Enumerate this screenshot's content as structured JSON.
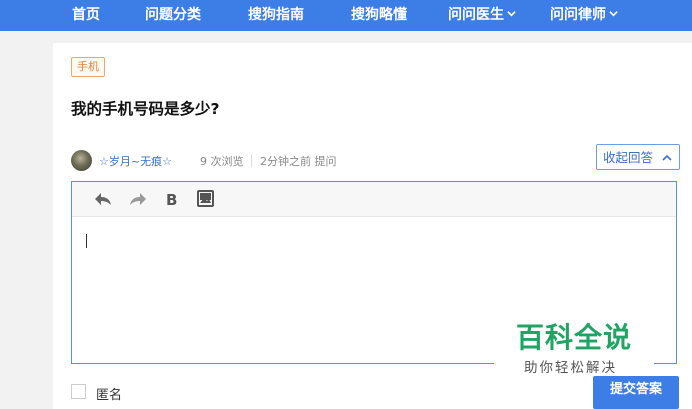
{
  "nav": {
    "items": [
      {
        "label": "首页"
      },
      {
        "label": "问题分类"
      },
      {
        "label": "搜狗指南"
      },
      {
        "label": "搜狗略懂"
      },
      {
        "label": "问问医生"
      },
      {
        "label": "问问律师"
      }
    ]
  },
  "question": {
    "tag": "手机",
    "title": "我的手机号码是多少?",
    "author": "☆岁月~无痕☆",
    "views": "9 次浏览",
    "time": "2分钟之前 提问"
  },
  "actions": {
    "collapse_label": "收起回答",
    "anonymous_label": "匿名",
    "submit_label": "提交答案"
  },
  "editor": {
    "toolbar": [
      "undo-icon",
      "redo-icon",
      "bold-icon",
      "image-icon"
    ],
    "value": ""
  },
  "watermark": {
    "title": "百科全说",
    "subtitle": "助你轻松解决"
  },
  "colors": {
    "nav_bg": "#3d7ee6",
    "accent": "#3d7ee6",
    "tag": "#ef7f32",
    "watermark": "#20a464"
  }
}
